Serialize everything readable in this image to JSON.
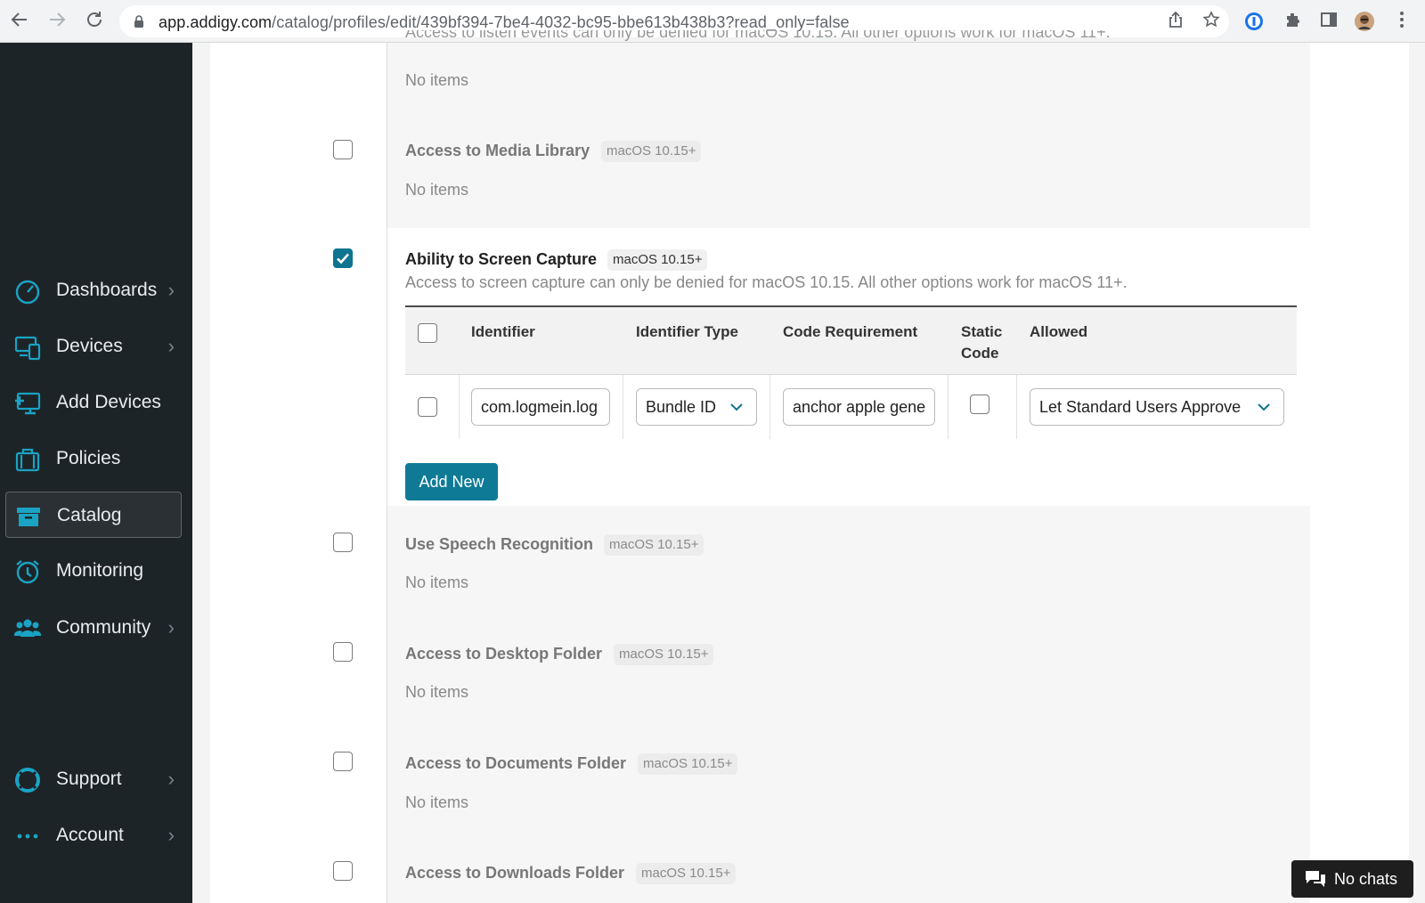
{
  "browser": {
    "url_host": "app.addigy.com",
    "url_path": "/catalog/profiles/edit/439bf394-7be4-4032-bc95-bbe613b438b3?read_only=false"
  },
  "sidebar": {
    "items": [
      {
        "label": "Dashboards",
        "icon": "gauge-icon",
        "has_arrow": true
      },
      {
        "label": "Devices",
        "icon": "devices-icon",
        "has_arrow": true
      },
      {
        "label": "Add Devices",
        "icon": "add-device-icon",
        "has_arrow": false
      },
      {
        "label": "Policies",
        "icon": "briefcase-icon",
        "has_arrow": false
      },
      {
        "label": "Catalog",
        "icon": "catalog-icon",
        "has_arrow": false,
        "active": true
      },
      {
        "label": "Monitoring",
        "icon": "alarm-clock-icon",
        "has_arrow": false
      },
      {
        "label": "Community",
        "icon": "users-icon",
        "has_arrow": true
      },
      {
        "label": "Support",
        "icon": "lifebuoy-icon",
        "has_arrow": true
      },
      {
        "label": "Account",
        "icon": "dots-icon",
        "has_arrow": true
      }
    ]
  },
  "content": {
    "top_cut_text": "Access to listen events can only be denied for macOS 10.15. All other options work for macOS 11+.",
    "no_items": "No items",
    "sections": [
      {
        "title": "Access to Media Library",
        "badge": "macOS 10.15+",
        "checked": false
      },
      {
        "title": "Ability to Screen Capture",
        "badge": "macOS 10.15+",
        "checked": true,
        "description": "Access to screen capture can only be denied for macOS 10.15. All other options work for macOS 11+."
      },
      {
        "title": "Use Speech Recognition",
        "badge": "macOS 10.15+",
        "checked": false
      },
      {
        "title": "Access to Desktop Folder",
        "badge": "macOS 10.15+",
        "checked": false
      },
      {
        "title": "Access to Documents Folder",
        "badge": "macOS 10.15+",
        "checked": false
      },
      {
        "title": "Access to Downloads Folder",
        "badge": "macOS 10.15+",
        "checked": false
      }
    ],
    "table": {
      "headers": {
        "identifier": "Identifier",
        "identifier_type": "Identifier Type",
        "code_requirement": "Code Requirement",
        "static_line1": "Static",
        "static_line2": "Code",
        "allowed": "Allowed"
      },
      "row": {
        "identifier": "com.logmein.log",
        "identifier_type": "Bundle ID",
        "code_requirement": "anchor apple gene",
        "static_code": false,
        "allowed": "Let Standard Users Approve"
      }
    },
    "add_new_label": "Add New"
  },
  "chat": {
    "label": "No chats"
  },
  "colors": {
    "accent": "#0e7490",
    "sidebar_bg": "#1d2427",
    "icon_teal": "#1aa3c4"
  }
}
